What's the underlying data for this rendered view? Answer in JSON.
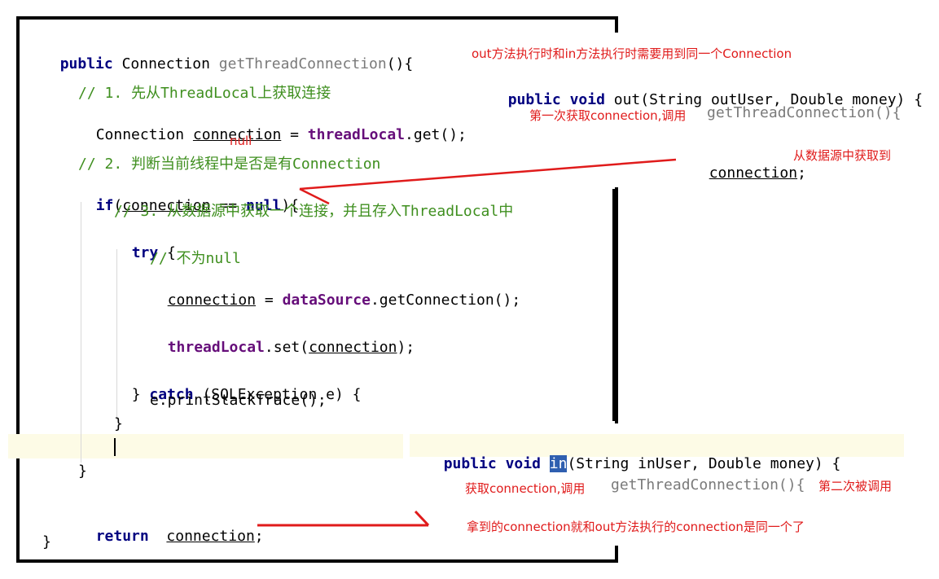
{
  "code_left": {
    "line1": {
      "kw": "public",
      "type": "Connection",
      "name": "getThreadConnection",
      "tail": "(){"
    },
    "comment1": "// 1. 先从ThreadLocal上获取连接",
    "line3": {
      "type": "Connection",
      "var": "connection",
      "op": " = ",
      "field": "threadLocal",
      "call": ".get();"
    },
    "null_note": "null",
    "comment2": "// 2. 判断当前线程中是否是有Connection",
    "line5": {
      "kw": "if",
      "open": "(",
      "var": "connection",
      "op": " == ",
      "kw2": "null",
      "tail": "){"
    },
    "comment3": "// 3. 从数据源中获取一个连接，并且存入ThreadLocal中",
    "line7": {
      "kw": "try",
      "tail": " {"
    },
    "comment4": "// 不为null",
    "line9": {
      "var": "connection",
      "op": " = ",
      "field": "dataSource",
      "call": ".getConnection();"
    },
    "line10": {
      "field": "threadLocal",
      "call": ".set(",
      "var": "connection",
      "tail": ");"
    },
    "line11": {
      "open": "} ",
      "kw": "catch",
      "tail": " (SQLException e) {"
    },
    "line12": "e.printStackTrace();",
    "line13": "}",
    "line14": "}",
    "line15": {
      "kw": "return",
      "var": "connection",
      "tail": ";"
    },
    "line16": "}"
  },
  "right_top": {
    "note1": "out方法执行时和in方法执行时需要用到同一个Connection",
    "sig": {
      "kw1": "public",
      "kw2": "void",
      "rest": " out(String outUser, Double money) {"
    },
    "note2": "第一次获取connection,调用",
    "call": "getThreadConnection(){",
    "conn": "connection",
    "semi": ";",
    "note3": "从数据源中获取到"
  },
  "right_bottom": {
    "sig": {
      "kw1": "public",
      "kw2": "void",
      "hl": "in",
      "rest": "(String inUser, Double money) {"
    },
    "note1": "获取connection,调用",
    "call": "getThreadConnection(){",
    "note2": "第二次被调用",
    "note3": "拿到的connection就和out方法执行的connection是同一个了"
  },
  "colors": {
    "annotation": "#e01b1b",
    "keyword": "#000080",
    "comment": "#3f8f1f",
    "field": "#660e7a",
    "highlight": "#2f5fb0"
  }
}
